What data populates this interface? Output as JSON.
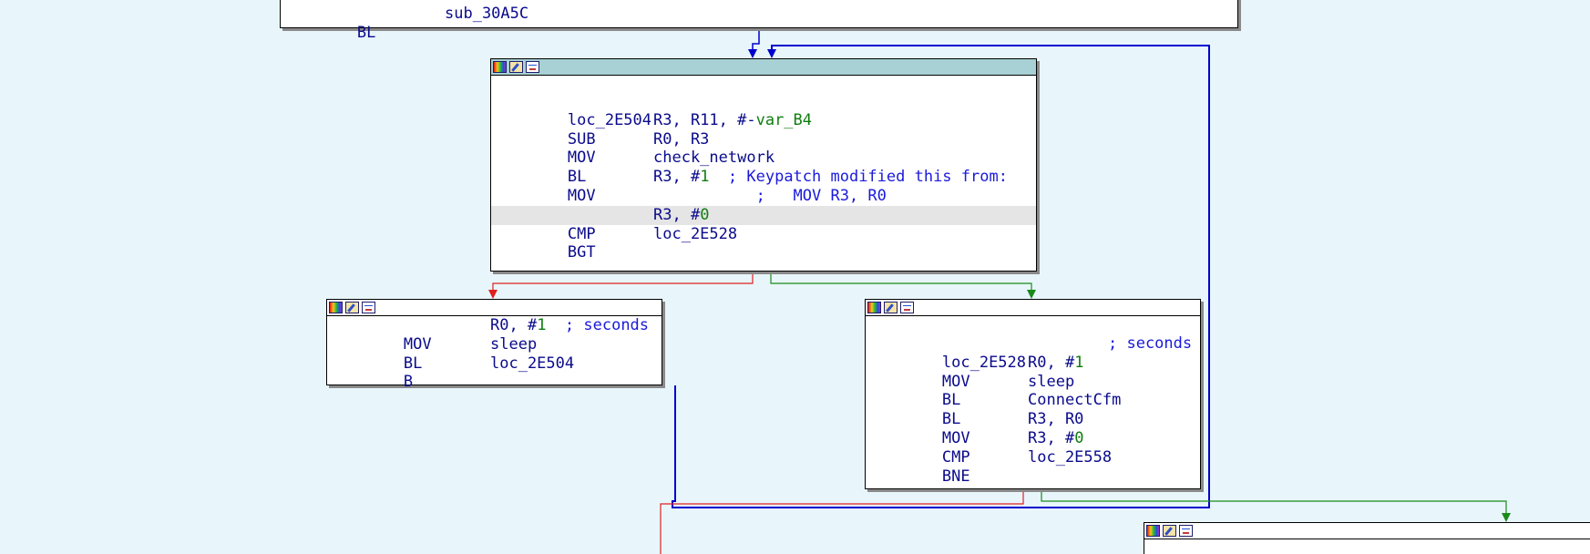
{
  "nodes": {
    "top": {
      "lines": [
        {
          "m": "BL",
          "ops": "sub_30A5C"
        }
      ]
    },
    "loc_2E504": {
      "label": "loc_2E504",
      "lines": [
        {
          "m": "SUB",
          "ops_pre": "R3, R11, #-",
          "ops_var": "var_B4"
        },
        {
          "m": "MOV",
          "ops": "R0, R3"
        },
        {
          "m": "BL",
          "ops": "check_network"
        },
        {
          "m": "MOV",
          "ops_pre": "R3, #",
          "ops_num": "1",
          "comment": "  ; Keypatch modified this from:"
        },
        {
          "m": "",
          "ops": "",
          "comment": "           ;   MOV R3, R0"
        },
        {
          "m": "CMP",
          "ops_pre": "R3, #",
          "ops_num": "0"
        },
        {
          "m": "BGT",
          "ops": "loc_2E528"
        }
      ]
    },
    "sleep_loop": {
      "lines": [
        {
          "m": "MOV",
          "ops_pre": "R0, #",
          "ops_num": "1",
          "comment": "  ; seconds"
        },
        {
          "m": "BL",
          "ops": "sleep"
        },
        {
          "m": "B",
          "ops": "loc_2E504"
        }
      ]
    },
    "loc_2E528": {
      "label": "loc_2E528",
      "label_comment": "; seconds",
      "lines": [
        {
          "m": "MOV",
          "ops_pre": "R0, #",
          "ops_num": "1"
        },
        {
          "m": "BL",
          "ops": "sleep"
        },
        {
          "m": "BL",
          "ops": "ConnectCfm"
        },
        {
          "m": "MOV",
          "ops": "R3, R0"
        },
        {
          "m": "CMP",
          "ops_pre": "R3, #",
          "ops_num": "0"
        },
        {
          "m": "BNE",
          "ops": "loc_2E558"
        }
      ]
    }
  },
  "colors": {
    "background": "#e8f6fc",
    "edge_unconditional": "#0000cc",
    "edge_true": "#1a8a1a",
    "edge_false": "#e02020",
    "selected_titlebar": "#a7d1d4",
    "code_text": "#0b0b8c",
    "immediate": "#0f7d0f",
    "comment": "#1a1adb"
  },
  "icons": [
    "color-palette-icon",
    "edit-pencil-icon",
    "graph-overview-icon"
  ]
}
